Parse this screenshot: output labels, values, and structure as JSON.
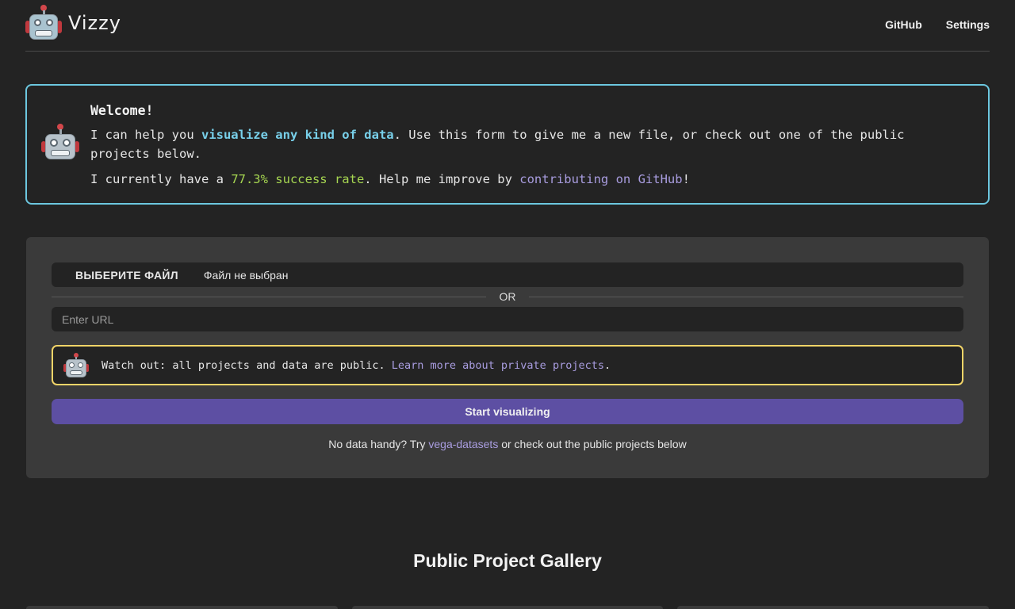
{
  "header": {
    "brand": "Vizzy",
    "nav": {
      "github": "GitHub",
      "settings": "Settings"
    }
  },
  "welcome": {
    "title": "Welcome!",
    "line1_pre": "I can help you ",
    "line1_highlight": "visualize any kind of data",
    "line1_post": ". Use this form to give me a new file, or check out one of the public projects below.",
    "line2_pre": "I currently have a ",
    "success_rate": "77.3% success rate",
    "line2_mid": ". Help me improve by ",
    "line2_link": "contributing on GitHub",
    "line2_post": "!"
  },
  "form": {
    "file_button": "ВЫБЕРИТЕ ФАЙЛ",
    "file_status": "Файл не выбран",
    "or_label": "OR",
    "url_placeholder": "Enter URL",
    "warning_text": "Watch out: all projects and data are public. ",
    "warning_link": "Learn more about private projects",
    "warning_end": ".",
    "start_button": "Start visualizing",
    "hint_pre": "No data handy? Try ",
    "hint_link": "vega-datasets",
    "hint_post": " or check out the public projects below"
  },
  "gallery": {
    "title": "Public Project Gallery"
  },
  "colors": {
    "background": "#232323",
    "card": "#3a3a3a",
    "welcome_border": "#6cc7df",
    "warning_border": "#f2d468",
    "primary_button": "#5d4fa3",
    "link": "#a99de0",
    "highlight_blue": "#78d0ea",
    "highlight_green": "#a6d651"
  },
  "icons": {
    "logo": "robot-icon",
    "welcome": "robot-icon",
    "warning": "robot-icon"
  }
}
